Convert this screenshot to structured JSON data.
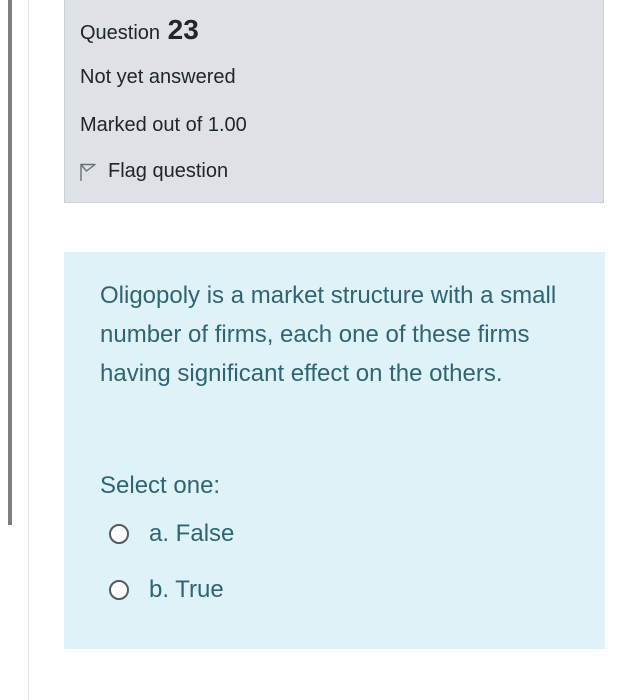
{
  "question_info": {
    "label": "Question",
    "number": "23",
    "state": "Not yet answered",
    "grade": "Marked out of 1.00",
    "flag_label": "Flag question"
  },
  "question": {
    "text": "Oligopoly is a market structure with a small number of firms, each one of these firms having significant effect on the others.",
    "prompt": "Select one:",
    "options": [
      {
        "label": "a. False",
        "selected": false
      },
      {
        "label": "b. True",
        "selected": false
      }
    ]
  },
  "colors": {
    "info_background": "#dee2e6",
    "content_background": "#def2f8",
    "content_text": "#2f6473"
  }
}
